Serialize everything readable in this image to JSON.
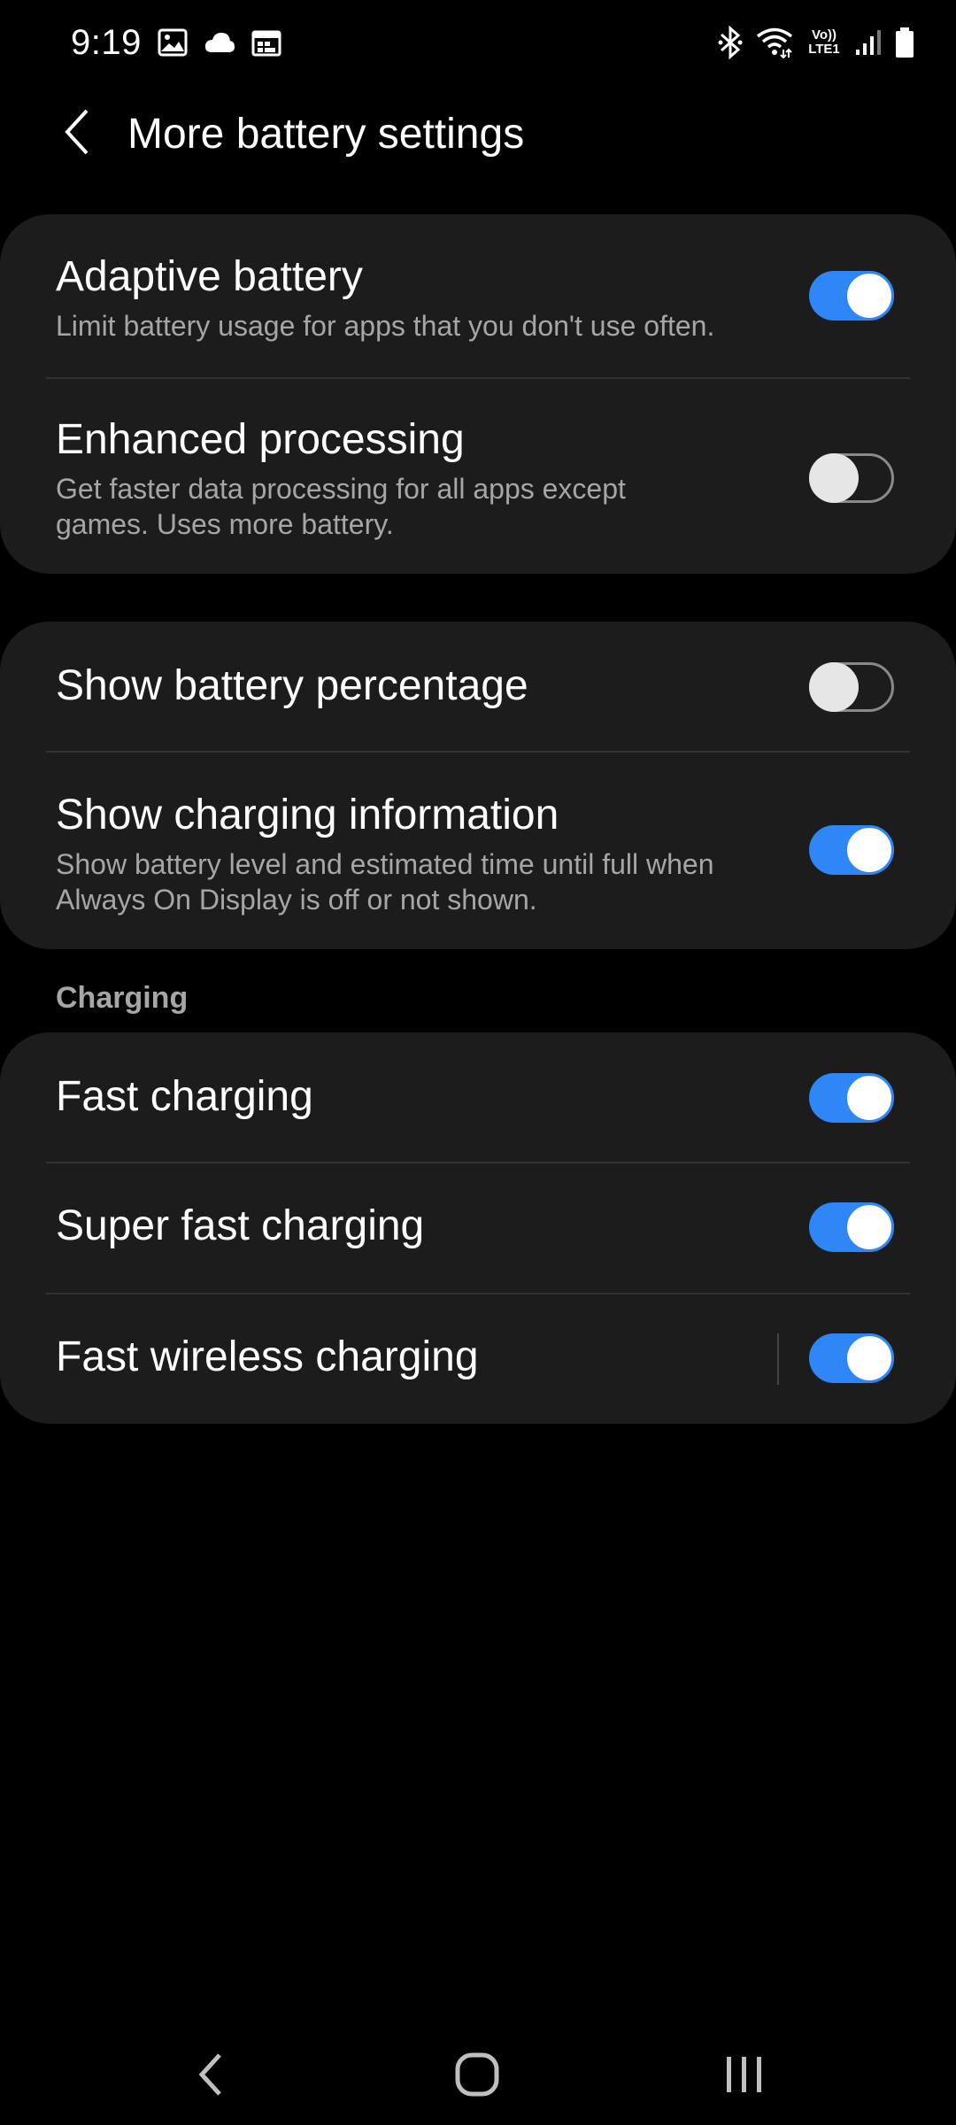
{
  "status_bar": {
    "time": "9:19",
    "left_icons": [
      "image-icon",
      "cloud-icon",
      "calendar-icon"
    ],
    "right_icons": [
      "bluetooth-icon",
      "wifi-icon",
      "volte-lte-icon",
      "signal-icon",
      "battery-icon"
    ],
    "volte_text": "Vo))",
    "lte_text": "LTE1"
  },
  "header": {
    "title": "More battery settings",
    "back_icon": "chevron-left-icon"
  },
  "colors": {
    "background": "#000000",
    "card": "#1c1c1c",
    "toggle_on": "#2f86f6",
    "subtitle": "#a6a6a6"
  },
  "cards": [
    {
      "items": [
        {
          "title": "Adaptive battery",
          "subtitle": "Limit battery usage for apps that you don't use often.",
          "enabled": true
        },
        {
          "title": "Enhanced processing",
          "subtitle": "Get faster data processing for all apps except games. Uses more battery.",
          "enabled": false
        }
      ]
    },
    {
      "items": [
        {
          "title": "Show battery percentage",
          "subtitle": "",
          "enabled": false
        },
        {
          "title": "Show charging information",
          "subtitle": "Show battery level and estimated time until full when Always On Display is off or not shown.",
          "enabled": true
        }
      ]
    },
    {
      "section_label": "Charging",
      "items": [
        {
          "title": "Fast charging",
          "enabled": true
        },
        {
          "title": "Super fast charging",
          "enabled": true
        },
        {
          "title": "Fast wireless charging",
          "enabled": true
        }
      ]
    }
  ],
  "nav_bar": {
    "back": "back-nav-icon",
    "home": "home-nav-icon",
    "recents": "recents-nav-icon"
  }
}
